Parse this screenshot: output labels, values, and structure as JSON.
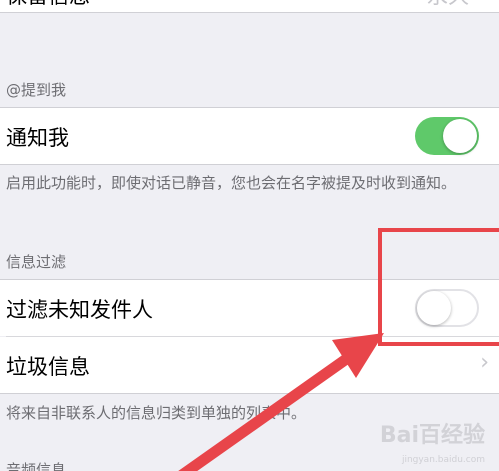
{
  "top_row": {
    "label": "保留信息",
    "value": "永久"
  },
  "mentions": {
    "header": "@提到我",
    "notify": {
      "label": "通知我",
      "enabled": true
    },
    "footer": "启用此功能时，即使对话已静音，您也会在名字被提及时收到通知。"
  },
  "filtering": {
    "header": "信息过滤",
    "filter_unknown": {
      "label": "过滤未知发件人",
      "enabled": false
    },
    "junk": {
      "label": "垃圾信息"
    },
    "footer": "将来自非联系人的信息归类到单独的列表中。"
  },
  "audio": {
    "header": "音频信息"
  },
  "annotation_color": "#e8454a",
  "toggle_on_color": "#5fc96a",
  "watermark": {
    "brand": "Bai百经验",
    "url": "jingyan.baidu.com"
  }
}
